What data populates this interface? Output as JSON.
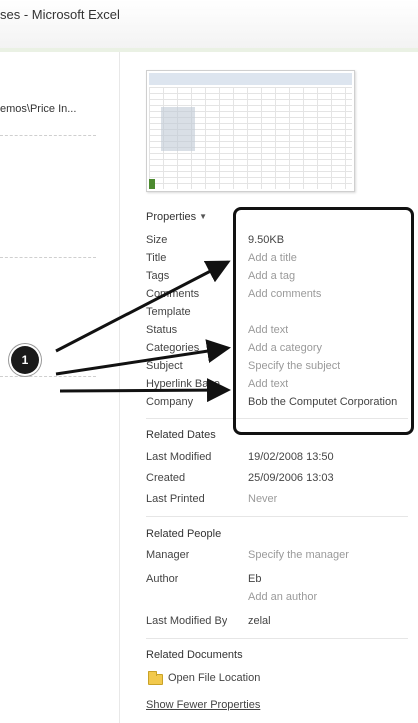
{
  "window": {
    "title": "ses  -  Microsoft Excel"
  },
  "left_pane": {
    "path_text": "emos\\Price In..."
  },
  "thumbnail": {
    "icon": "document-preview-icon"
  },
  "properties": {
    "heading": "Properties",
    "rows": [
      {
        "label": "Size",
        "value": "9.50KB",
        "kind": "set"
      },
      {
        "label": "Title",
        "value": "Add a title",
        "kind": "placeholder"
      },
      {
        "label": "Tags",
        "value": "Add a tag",
        "kind": "placeholder"
      },
      {
        "label": "Comments",
        "value": "Add comments",
        "kind": "placeholder"
      },
      {
        "label": "Template",
        "value": "",
        "kind": "set"
      },
      {
        "label": "Status",
        "value": "Add text",
        "kind": "placeholder"
      },
      {
        "label": "Categories",
        "value": "Add a category",
        "kind": "placeholder"
      },
      {
        "label": "Subject",
        "value": "Specify the subject",
        "kind": "placeholder"
      },
      {
        "label": "Hyperlink Base",
        "value": "Add text",
        "kind": "placeholder"
      },
      {
        "label": "Company",
        "value": "Bob the Computet Corporation",
        "kind": "set"
      }
    ]
  },
  "related_dates": {
    "heading": "Related Dates",
    "rows": [
      {
        "label": "Last Modified",
        "value": "19/02/2008 13:50",
        "kind": "set"
      },
      {
        "label": "Created",
        "value": "25/09/2006 13:03",
        "kind": "set"
      },
      {
        "label": "Last Printed",
        "value": "Never",
        "kind": "placeholder"
      }
    ]
  },
  "related_people": {
    "heading": "Related People",
    "manager_label": "Manager",
    "manager_value": "Specify the manager",
    "author_label": "Author",
    "author_value": "Eb",
    "add_author": "Add an author",
    "last_modified_by_label": "Last Modified By",
    "last_modified_by_value": "zelal"
  },
  "related_documents": {
    "heading": "Related Documents",
    "open_file_location": "Open File Location",
    "folder_icon": "folder-icon"
  },
  "show_fewer": "Show Fewer Properties",
  "annotation": {
    "step_number": "1"
  },
  "colors": {
    "placeholder_text": "#9a9a9a",
    "label_text": "#444444",
    "annotation": "#111111"
  }
}
